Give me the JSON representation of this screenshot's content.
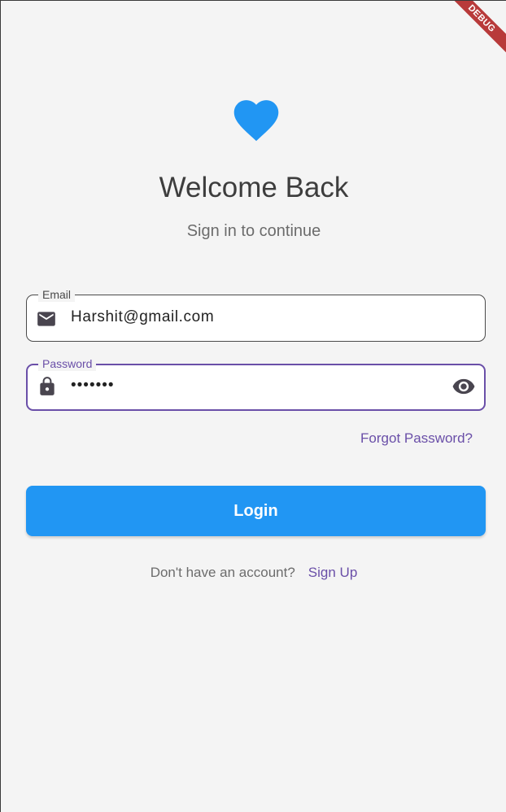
{
  "debug_banner": "DEBUG",
  "header": {
    "icon": "heart-icon",
    "title": "Welcome Back",
    "subtitle": "Sign in to continue"
  },
  "form": {
    "email": {
      "label": "Email",
      "value": "Harshit@gmail.com",
      "icon": "email-icon"
    },
    "password": {
      "label": "Password",
      "value": "•••••••",
      "icon": "lock-icon",
      "toggle_icon": "eye-icon"
    },
    "forgot_password": "Forgot Password?",
    "login_label": "Login"
  },
  "signup": {
    "prompt": "Don't have an account?",
    "link": "Sign Up"
  },
  "colors": {
    "primary": "#2196f3",
    "accent": "#6a4fa8",
    "background": "#f4f4f4",
    "debug_ribbon": "#b83a3a"
  }
}
